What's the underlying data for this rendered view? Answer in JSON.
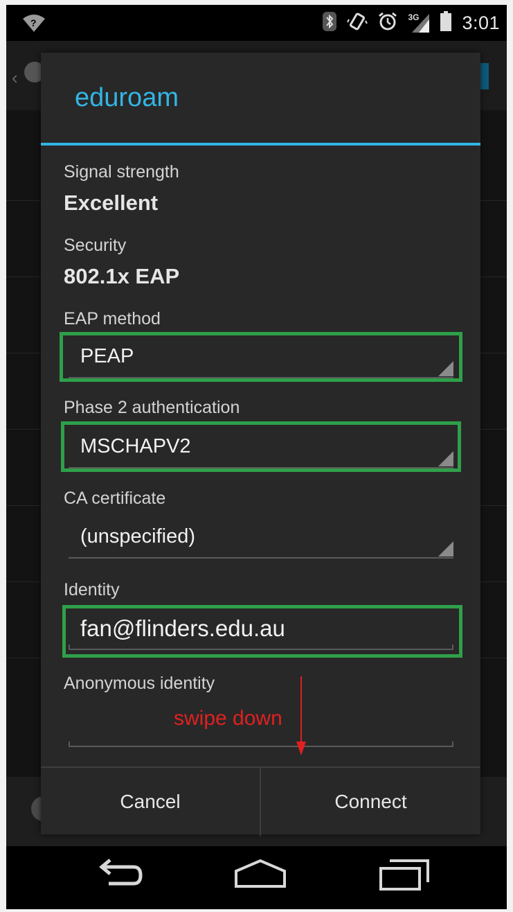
{
  "status_bar": {
    "time": "3:01",
    "network_type": "3G",
    "icons": [
      "wifi-question-icon",
      "bluetooth-icon",
      "vibrate-icon",
      "alarm-icon",
      "signal-icon",
      "battery-icon"
    ]
  },
  "dialog": {
    "title": "eduroam",
    "signal_strength": {
      "label": "Signal strength",
      "value": "Excellent"
    },
    "security": {
      "label": "Security",
      "value": "802.1x EAP"
    },
    "eap_method": {
      "label": "EAP method",
      "value": "PEAP"
    },
    "phase2": {
      "label": "Phase 2 authentication",
      "value": "MSCHAPV2"
    },
    "ca_certificate": {
      "label": "CA certificate",
      "value": "(unspecified)"
    },
    "identity": {
      "label": "Identity",
      "value": "fan@flinders.edu.au"
    },
    "anonymous_identity": {
      "label": "Anonymous identity",
      "value": ""
    },
    "buttons": {
      "cancel": "Cancel",
      "connect": "Connect"
    }
  },
  "annotation": {
    "text": "swipe down"
  },
  "colors": {
    "accent": "#33b5e5",
    "highlight": "#2fa04a",
    "annotation": "#e02020"
  },
  "nav_bar": {
    "icons": [
      "back-icon",
      "home-icon",
      "recents-icon"
    ]
  }
}
